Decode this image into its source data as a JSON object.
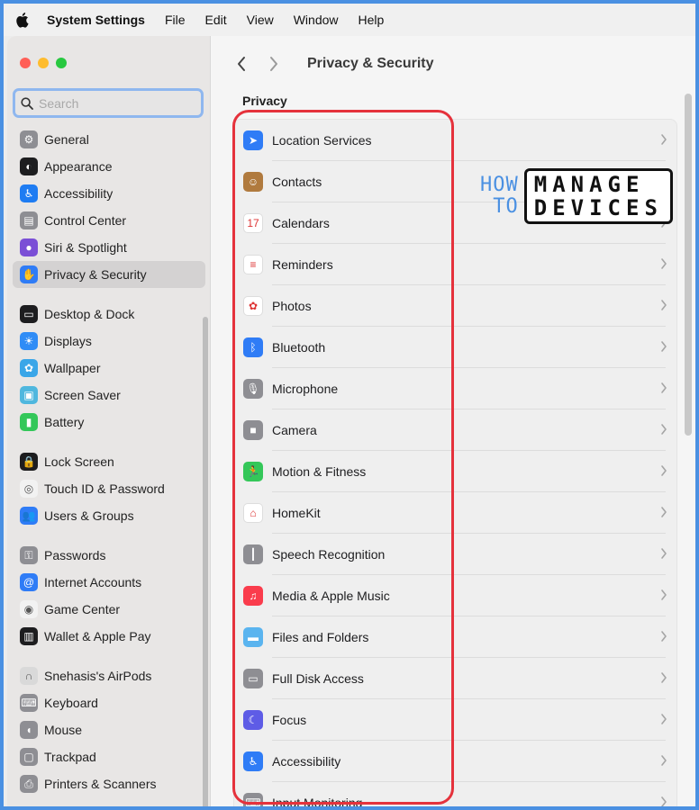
{
  "menubar": {
    "app_name": "System Settings",
    "items": [
      "File",
      "Edit",
      "View",
      "Window",
      "Help"
    ]
  },
  "search": {
    "placeholder": "Search"
  },
  "sidebar": {
    "groups": [
      [
        {
          "label": "General",
          "icon": "gear-icon",
          "color": "#8e8e93"
        },
        {
          "label": "Appearance",
          "icon": "appearance-icon",
          "color": "#1d1d1f"
        },
        {
          "label": "Accessibility",
          "icon": "accessibility-icon",
          "color": "#1e7cf2"
        },
        {
          "label": "Control Center",
          "icon": "control-center-icon",
          "color": "#8e8e93"
        },
        {
          "label": "Siri & Spotlight",
          "icon": "siri-icon",
          "color": "#7b4fd6"
        },
        {
          "label": "Privacy & Security",
          "icon": "hand-icon",
          "color": "#2f7cf6",
          "selected": true
        }
      ],
      [
        {
          "label": "Desktop & Dock",
          "icon": "dock-icon",
          "color": "#1d1d1f"
        },
        {
          "label": "Displays",
          "icon": "sun-icon",
          "color": "#2f8cf6"
        },
        {
          "label": "Wallpaper",
          "icon": "flower-icon",
          "color": "#3aa6e8"
        },
        {
          "label": "Screen Saver",
          "icon": "screen-saver-icon",
          "color": "#4fb7de"
        },
        {
          "label": "Battery",
          "icon": "battery-icon",
          "color": "#33c759"
        }
      ],
      [
        {
          "label": "Lock Screen",
          "icon": "lock-icon",
          "color": "#1d1d1f"
        },
        {
          "label": "Touch ID & Password",
          "icon": "fingerprint-icon",
          "color": "#f2f2f2"
        },
        {
          "label": "Users & Groups",
          "icon": "users-icon",
          "color": "#2f7cf6"
        }
      ],
      [
        {
          "label": "Passwords",
          "icon": "key-icon",
          "color": "#8e8e93"
        },
        {
          "label": "Internet Accounts",
          "icon": "at-icon",
          "color": "#2f7cf6"
        },
        {
          "label": "Game Center",
          "icon": "game-center-icon",
          "color": "#f2f2f2"
        },
        {
          "label": "Wallet & Apple Pay",
          "icon": "wallet-icon",
          "color": "#1d1d1f"
        }
      ],
      [
        {
          "label": "Snehasis's AirPods",
          "icon": "airpods-icon",
          "color": "#d9d9d9"
        },
        {
          "label": "Keyboard",
          "icon": "keyboard-icon",
          "color": "#8e8e93"
        },
        {
          "label": "Mouse",
          "icon": "mouse-icon",
          "color": "#8e8e93"
        },
        {
          "label": "Trackpad",
          "icon": "trackpad-icon",
          "color": "#8e8e93"
        },
        {
          "label": "Printers & Scanners",
          "icon": "printer-icon",
          "color": "#8e8e93"
        }
      ]
    ]
  },
  "main": {
    "title": "Privacy & Security",
    "section": "Privacy",
    "rows": [
      {
        "label": "Location Services",
        "icon": "location-arrow-icon",
        "color": "#2f7cf6"
      },
      {
        "label": "Contacts",
        "icon": "contacts-icon",
        "color": "#b07a3e"
      },
      {
        "label": "Calendars",
        "icon": "calendar-icon",
        "color": "#ffffff"
      },
      {
        "label": "Reminders",
        "icon": "reminders-icon",
        "color": "#ffffff"
      },
      {
        "label": "Photos",
        "icon": "photos-icon",
        "color": "#ffffff"
      },
      {
        "label": "Bluetooth",
        "icon": "bluetooth-icon",
        "color": "#2f7cf6"
      },
      {
        "label": "Microphone",
        "icon": "microphone-icon",
        "color": "#8e8e93"
      },
      {
        "label": "Camera",
        "icon": "camera-icon",
        "color": "#8e8e93"
      },
      {
        "label": "Motion & Fitness",
        "icon": "motion-icon",
        "color": "#34c759"
      },
      {
        "label": "HomeKit",
        "icon": "home-icon",
        "color": "#ffffff"
      },
      {
        "label": "Speech Recognition",
        "icon": "waveform-icon",
        "color": "#8e8e93"
      },
      {
        "label": "Media & Apple Music",
        "icon": "music-icon",
        "color": "#fa3c4c"
      },
      {
        "label": "Files and Folders",
        "icon": "folder-icon",
        "color": "#5ab4ef"
      },
      {
        "label": "Full Disk Access",
        "icon": "disk-icon",
        "color": "#8e8e93"
      },
      {
        "label": "Focus",
        "icon": "moon-icon",
        "color": "#5e5ce6"
      },
      {
        "label": "Accessibility",
        "icon": "accessibility-icon",
        "color": "#2f7cf6"
      },
      {
        "label": "Input Monitoring",
        "icon": "keyboard-icon",
        "color": "#8e8e93"
      }
    ]
  },
  "watermark": {
    "line1": "HOW",
    "line2": "TO",
    "box_line1": "MANAGE",
    "box_line2": "DEVICES"
  },
  "colors": {
    "highlight": "#e5323c",
    "accent": "#2f7cf6",
    "frame": "#4a90e2"
  }
}
